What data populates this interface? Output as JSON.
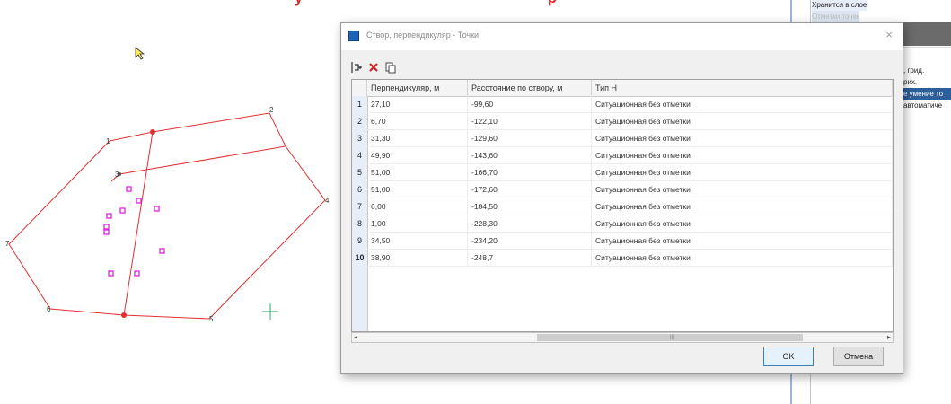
{
  "window": {
    "title": "Створ, перпендикуляр - Точки",
    "close_label": "×"
  },
  "toolbar": {
    "insert_icon": "insert-row-icon",
    "delete_icon": "delete-x-icon",
    "copy_icon": "copy-icon"
  },
  "table": {
    "columns": [
      "Перпендикуляр, м",
      "Расстояние по створу, м",
      "Тип Н"
    ],
    "rows": [
      {
        "num": "1",
        "perp": "27,10",
        "dist": "-99,60",
        "type": "Ситуационная без отметки"
      },
      {
        "num": "2",
        "perp": "6,70",
        "dist": "-122,10",
        "type": "Ситуационная без отметки"
      },
      {
        "num": "3",
        "perp": "31,30",
        "dist": "-129,60",
        "type": "Ситуационная без отметки"
      },
      {
        "num": "4",
        "perp": "49,90",
        "dist": "-143,60",
        "type": "Ситуационная без отметки"
      },
      {
        "num": "5",
        "perp": "51,00",
        "dist": "-166,70",
        "type": "Ситуационная без отметки"
      },
      {
        "num": "6",
        "perp": "51,00",
        "dist": "-172,60",
        "type": "Ситуационная без отметки"
      },
      {
        "num": "7",
        "perp": "6,00",
        "dist": "-184,50",
        "type": "Ситуационная без отметки"
      },
      {
        "num": "8",
        "perp": "1,00",
        "dist": "-228,30",
        "type": "Ситуационная без отметки"
      },
      {
        "num": "9",
        "perp": "34,50",
        "dist": "-234,20",
        "type": "Ситуационная без отметки"
      },
      {
        "num": "10",
        "perp": "38,90",
        "dist": "-248,7",
        "type": "Ситуационная без отметки"
      }
    ]
  },
  "buttons": {
    "ok": "OK",
    "cancel": "Отмена"
  },
  "right_panel": {
    "items": [
      "Хранится в слое",
      "Отметки точек",
      "",
      "",
      ", грид.",
      "рих.",
      "е умение то",
      "автоматиче"
    ]
  },
  "drawing": {
    "vertex_labels": [
      "1",
      "2",
      "3",
      "4",
      "5",
      "6",
      "7"
    ],
    "colors": {
      "polygon": "#e03030",
      "points": "#e020e0",
      "crosshair": "#2aa66a"
    }
  }
}
